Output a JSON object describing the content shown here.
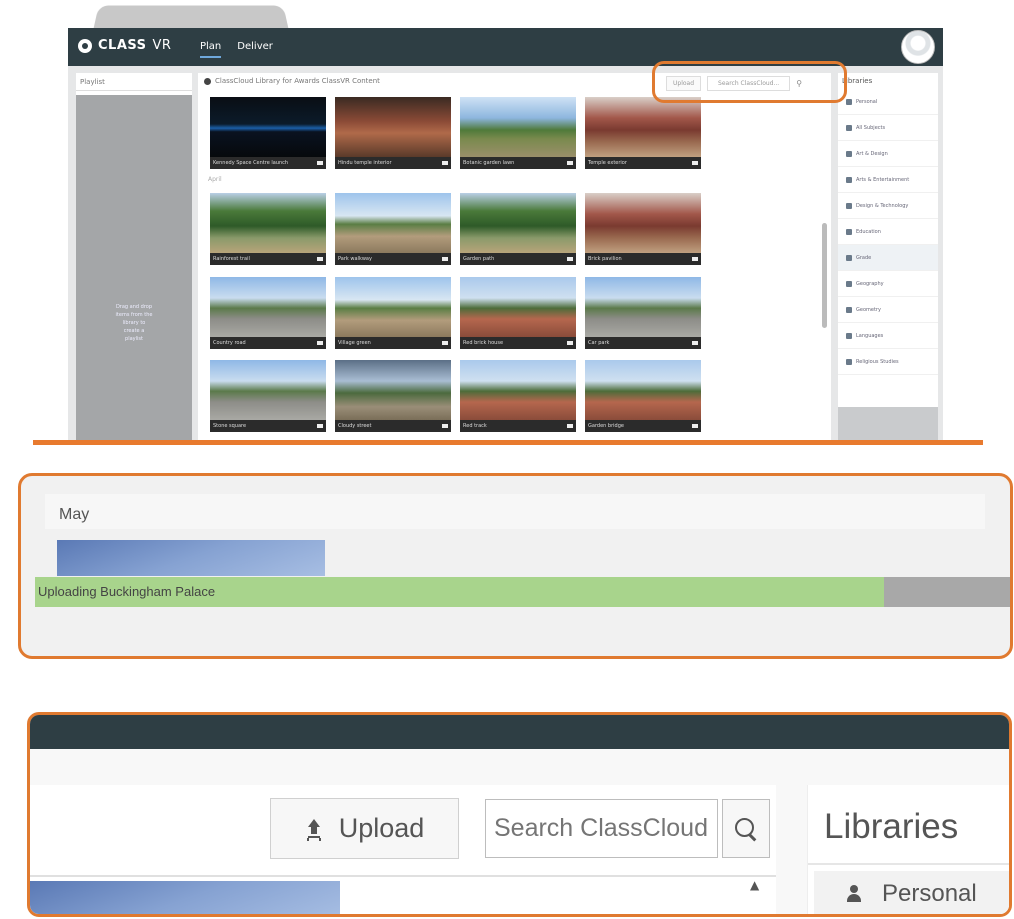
{
  "app": {
    "brand": "CLASS",
    "brand_suffix": "VR",
    "nav": [
      {
        "label": "Plan",
        "active": true
      },
      {
        "label": "Deliver",
        "active": false
      }
    ]
  },
  "playlist": {
    "title": "Playlist",
    "hint": "Drag and drop items from the library to create a playlist"
  },
  "library": {
    "breadcrumb": "ClassCloud Library for Awards ClassVR Content",
    "upload_label": "Upload",
    "search_placeholder": "Search ClassCloud...",
    "section_label": "April",
    "thumbnails": [
      {
        "caption": "Kennedy Space Centre launch",
        "style": "pano-night"
      },
      {
        "caption": "Hindu temple interior",
        "style": "pano-red"
      },
      {
        "caption": "Botanic garden lawn",
        "style": "pano-park"
      },
      {
        "caption": "Temple exterior",
        "style": "pano-temple"
      },
      {
        "caption": "Rainforest trail",
        "style": "pano-forest"
      },
      {
        "caption": "Park walkway",
        "style": "pano-path"
      },
      {
        "caption": "Garden path",
        "style": "pano-forest"
      },
      {
        "caption": "Brick pavilion",
        "style": "pano-temple"
      },
      {
        "caption": "Country road",
        "style": "pano-road"
      },
      {
        "caption": "Village green",
        "style": "pano-path"
      },
      {
        "caption": "Red brick house",
        "style": "pano-redpath"
      },
      {
        "caption": "Car park",
        "style": "pano-road"
      },
      {
        "caption": "Stone square",
        "style": "pano-road"
      },
      {
        "caption": "Cloudy street",
        "style": "pano-cloud"
      },
      {
        "caption": "Red track",
        "style": "pano-redpath"
      },
      {
        "caption": "Garden bridge",
        "style": "pano-redpath"
      }
    ]
  },
  "libraries_panel": {
    "title": "Libraries",
    "items": [
      {
        "label": "Personal",
        "icon": "person-icon"
      },
      {
        "label": "All Subjects",
        "icon": "grid-icon"
      },
      {
        "label": "Art & Design",
        "icon": "palette-icon"
      },
      {
        "label": "Arts & Entertainment",
        "icon": "music-icon"
      },
      {
        "label": "Design & Technology",
        "icon": "wrench-icon"
      },
      {
        "label": "Education",
        "icon": "book-icon"
      },
      {
        "label": "Grade",
        "icon": "star-icon",
        "selected": true
      },
      {
        "label": "Geography",
        "icon": "globe-icon"
      },
      {
        "label": "Geometry",
        "icon": "shape-icon"
      },
      {
        "label": "Languages",
        "icon": "chat-icon"
      },
      {
        "label": "Religious Studies",
        "icon": "church-icon"
      }
    ]
  },
  "upload_panel": {
    "month": "May",
    "progress_label": "Uploading Buckingham Palace",
    "progress": 0.87
  },
  "zoom_panel": {
    "upload_label": "Upload",
    "search_placeholder": "Search ClassCloud...",
    "libraries_title": "Libraries",
    "personal_label": "Personal"
  },
  "colors": {
    "topbar": "#2e3e44",
    "highlight": "#e07a30",
    "progress": "#a8d48c",
    "progress_track": "#a8a8a8"
  }
}
